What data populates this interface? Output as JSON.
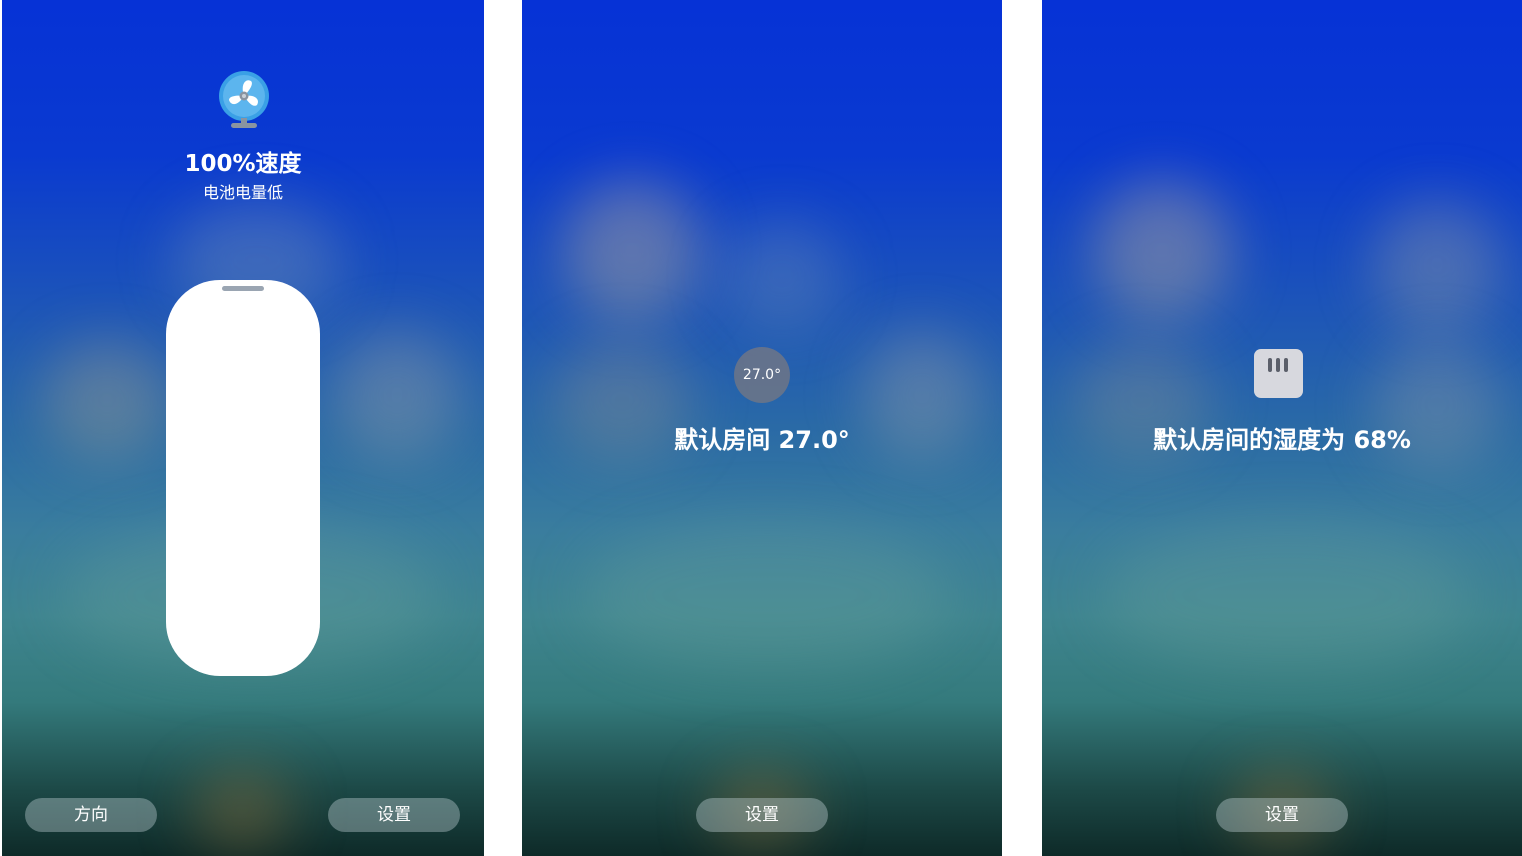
{
  "colors": {
    "background_top": "#0632d6",
    "background_bottom": "#0e2a28",
    "button_bg": "rgba(200,215,220,0.38)",
    "fan_blue": "#3aa0e6",
    "slider_fill": "#ffffff",
    "humidity_icon_bg": "#d7d8de",
    "temp_badge_bg": "#78787f"
  },
  "fan_screen": {
    "icon": "fan-icon",
    "speed_title": "100%速度",
    "subtitle": "电池电量低",
    "speed_percent": 100,
    "direction_button": "方向",
    "settings_button": "设置"
  },
  "thermostat_screen": {
    "badge_value": "27.0°",
    "status": "默认房间 27.0°",
    "settings_button": "设置"
  },
  "humidity_screen": {
    "icon": "humidity-sensor-icon",
    "status": "默认房间的湿度为 68%",
    "settings_button": "设置"
  }
}
